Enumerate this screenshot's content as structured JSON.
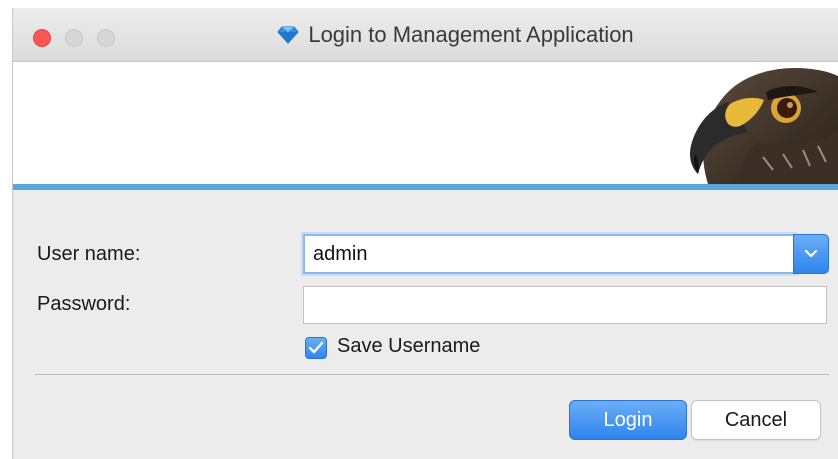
{
  "window": {
    "title": "Login to Management Application",
    "title_icon": "blue-diamond-icon"
  },
  "form": {
    "username_label": "User name:",
    "username_value": "admin",
    "password_label": "Password:",
    "password_value": "",
    "save_username_label": "Save Username",
    "save_username_checked": true
  },
  "buttons": {
    "login_label": "Login",
    "cancel_label": "Cancel"
  },
  "colors": {
    "accent": "#2f84ee",
    "banner_stripe": "#58a8d8",
    "close_button": "#fc5753"
  },
  "banner": {
    "image": "eagle-head-icon"
  }
}
